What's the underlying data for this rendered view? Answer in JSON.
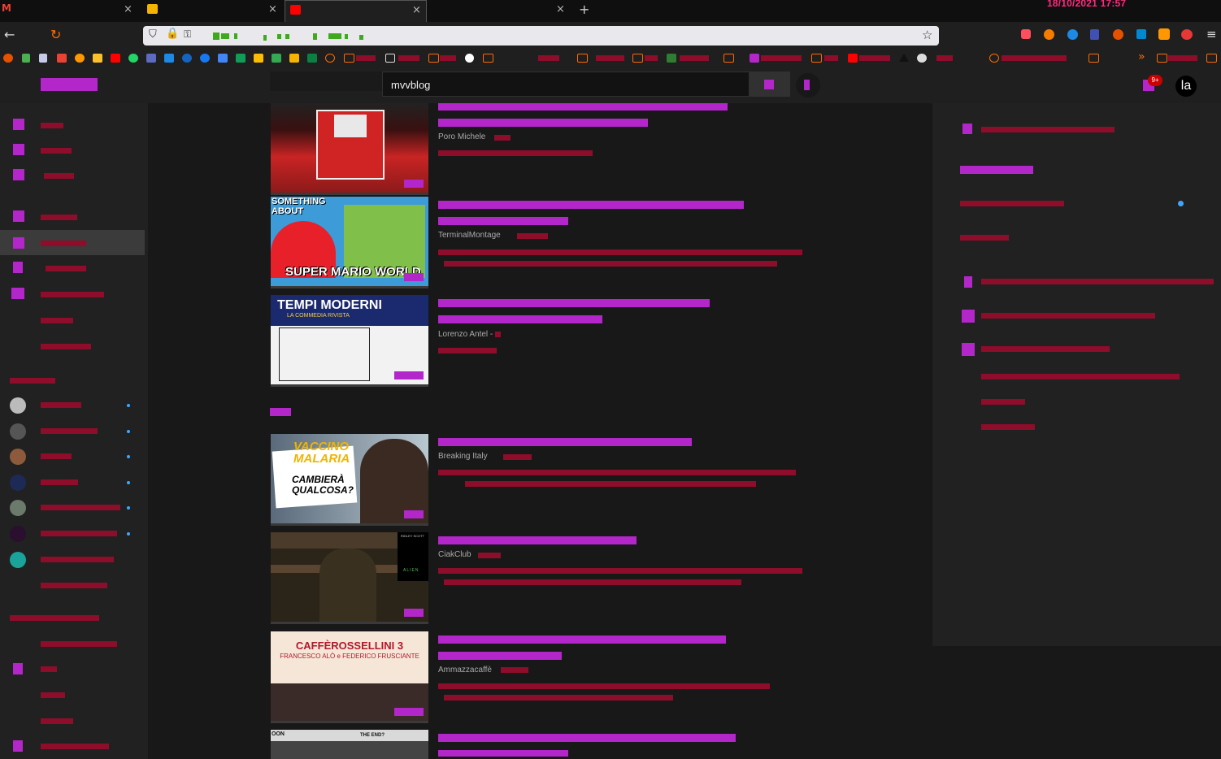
{
  "browser": {
    "clock": "18/10/2021  17:57",
    "new_tab": "+",
    "tab_close": "×",
    "back_icon": "←",
    "reload_icon": "↻",
    "star_icon": "☆",
    "menu_icon": "≡",
    "overflow_icon": "»"
  },
  "youtube": {
    "search_value": "mvvblog",
    "notification_badge": "9+",
    "avatar_initials": "la"
  },
  "results": [
    {
      "channel": "Poro Michele",
      "thumb_text": [],
      "bar_fraction": 1.0
    },
    {
      "channel": "TerminalMontage",
      "thumb_text": [
        "SOMETHING",
        "ABOUT",
        "SUPER MARIO WORLD"
      ],
      "bar_fraction": 0
    },
    {
      "channel": "Lorenzo Antel -",
      "thumb_text": [
        "TEMPI MODERNI",
        "LA COMMEDIA RIVISTA"
      ],
      "bar_fraction": 1.0
    },
    {
      "channel": "Breaking Italy",
      "thumb_text": [
        "VACCINO",
        "MALARIA",
        "CAMBIERÀ",
        "QUALCOSA?"
      ],
      "bar_fraction": 0.1
    },
    {
      "channel": "CiakClub",
      "thumb_text": [
        "RIDLEY SCOTT",
        "ALIEN"
      ],
      "bar_fraction": 0.25
    },
    {
      "channel": "Ammazzacaffè",
      "thumb_text": [
        "CAFFÈROSSELLINI 3",
        "FRANCESCO ALÒ e FEDERICO FRUSCIANTE"
      ],
      "bar_fraction": 0.1
    },
    {
      "channel": "",
      "thumb_text": [
        "OON",
        "THE END?"
      ],
      "bar_fraction": 0
    }
  ],
  "colors": {
    "accent": "#b326c9",
    "redact": "#8e0d2a",
    "clock": "#ff2a7f",
    "progress": "#e00000"
  }
}
